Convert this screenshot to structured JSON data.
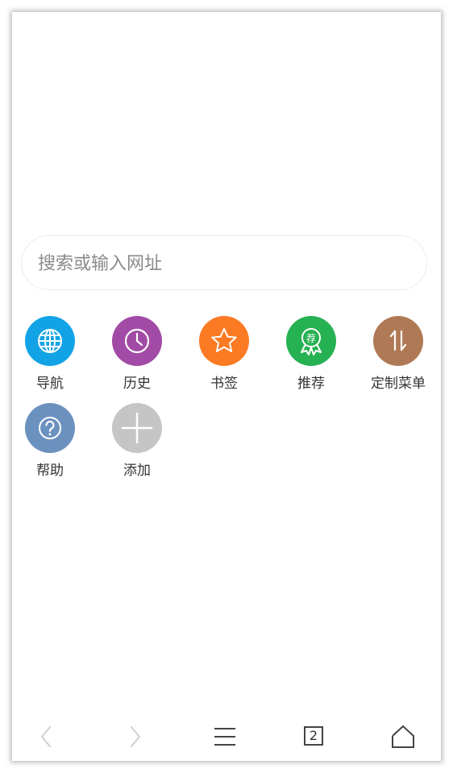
{
  "search": {
    "placeholder": "搜索或输入网址"
  },
  "shortcuts": [
    {
      "label": "导航",
      "icon": "globe-icon",
      "color": "#11a3e6"
    },
    {
      "label": "历史",
      "icon": "clock-icon",
      "color": "#a24ba6"
    },
    {
      "label": "书签",
      "icon": "star-icon",
      "color": "#fb7a23"
    },
    {
      "label": "推荐",
      "icon": "award-ribbon-icon",
      "color": "#26b153",
      "icon_text": "荐"
    },
    {
      "label": "定制菜单",
      "icon": "swap-arrows-icon",
      "color": "#b07955"
    },
    {
      "label": "帮助",
      "icon": "question-icon",
      "color": "#6b91bf"
    },
    {
      "label": "添加",
      "icon": "plus-icon",
      "color": "#c5c5c5"
    }
  ],
  "toolbar": {
    "back_icon": "chevron-left-icon",
    "forward_icon": "chevron-right-icon",
    "menu_icon": "hamburger-menu-icon",
    "tab_count": "2",
    "home_icon": "home-icon"
  }
}
